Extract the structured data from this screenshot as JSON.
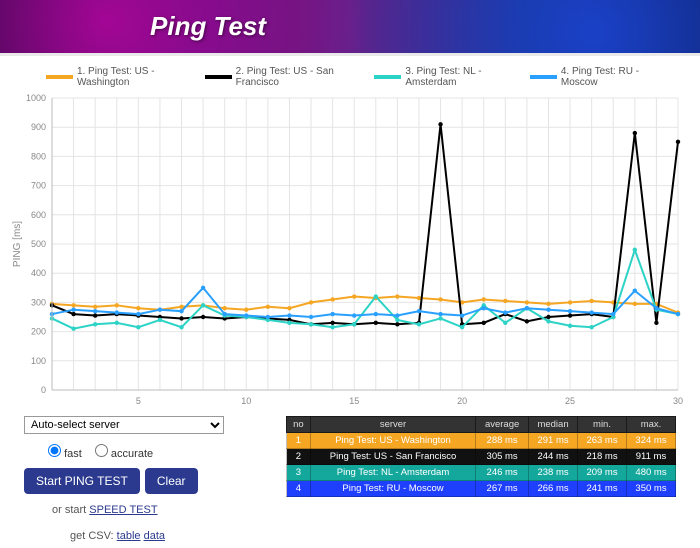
{
  "hero": {
    "title": "Ping Test"
  },
  "legend": [
    {
      "label": "1. Ping Test: US - Washington",
      "color": "#f5a623"
    },
    {
      "label": "2. Ping Test: US - San Francisco",
      "color": "#000000"
    },
    {
      "label": "3. Ping Test: NL - Amsterdam",
      "color": "#2dd3c6"
    },
    {
      "label": "4. Ping Test: RU - Moscow",
      "color": "#29a0ff"
    }
  ],
  "chart_data": {
    "type": "line",
    "title": "",
    "xlabel": "",
    "ylabel": "PING [ms]",
    "xlim": [
      1,
      30
    ],
    "ylim": [
      0,
      1000
    ],
    "xticks": [
      5,
      10,
      15,
      20,
      25,
      30
    ],
    "yticks": [
      0,
      100,
      200,
      300,
      400,
      500,
      600,
      700,
      800,
      900,
      1000
    ],
    "x": [
      1,
      2,
      3,
      4,
      5,
      6,
      7,
      8,
      9,
      10,
      11,
      12,
      13,
      14,
      15,
      16,
      17,
      18,
      19,
      20,
      21,
      22,
      23,
      24,
      25,
      26,
      27,
      28,
      29,
      30
    ],
    "series": [
      {
        "name": "1. Ping Test: US - Washington",
        "color": "#f5a623",
        "values": [
          295,
          290,
          285,
          290,
          280,
          275,
          285,
          290,
          280,
          275,
          285,
          280,
          300,
          310,
          320,
          315,
          320,
          315,
          310,
          300,
          310,
          305,
          300,
          295,
          300,
          305,
          300,
          295,
          295,
          265
        ]
      },
      {
        "name": "2. Ping Test: US - San Francisco",
        "color": "#000000",
        "values": [
          290,
          260,
          255,
          260,
          255,
          250,
          245,
          250,
          245,
          250,
          245,
          240,
          225,
          230,
          225,
          230,
          225,
          230,
          910,
          225,
          230,
          260,
          235,
          250,
          255,
          260,
          250,
          880,
          230,
          850
        ]
      },
      {
        "name": "3. Ping Test: NL - Amsterdam",
        "color": "#2dd3c6",
        "values": [
          245,
          210,
          225,
          230,
          215,
          240,
          215,
          290,
          255,
          250,
          240,
          230,
          225,
          215,
          225,
          320,
          240,
          225,
          245,
          215,
          290,
          230,
          280,
          235,
          220,
          215,
          250,
          480,
          275,
          260
        ]
      },
      {
        "name": "4. Ping Test: RU - Moscow",
        "color": "#29a0ff",
        "values": [
          260,
          275,
          270,
          265,
          260,
          275,
          270,
          350,
          260,
          255,
          250,
          255,
          250,
          260,
          255,
          260,
          255,
          270,
          260,
          255,
          280,
          265,
          280,
          275,
          270,
          265,
          260,
          340,
          280,
          260
        ]
      }
    ]
  },
  "controls": {
    "server_select": {
      "selected": "Auto-select server"
    },
    "mode": {
      "fast": "fast",
      "accurate": "accurate",
      "selected": "fast"
    },
    "start_btn": "Start PING TEST",
    "clear_btn": "Clear",
    "or_start_prefix": "or start ",
    "or_start_link": "SPEED TEST",
    "csv_prefix": "get CSV: ",
    "csv_table": "table",
    "csv_data": "data"
  },
  "results": {
    "headers": {
      "no": "no",
      "server": "server",
      "average": "average",
      "median": "median",
      "min": "min.",
      "max": "max."
    },
    "rows": [
      {
        "no": "1",
        "server": "Ping Test: US - Washington",
        "avg": "288 ms",
        "med": "291 ms",
        "min": "263 ms",
        "max": "324 ms",
        "bg": "#f5a623"
      },
      {
        "no": "2",
        "server": "Ping Test: US - San Francisco",
        "avg": "305 ms",
        "med": "244 ms",
        "min": "218 ms",
        "max": "911 ms",
        "bg": "#111111"
      },
      {
        "no": "3",
        "server": "Ping Test: NL - Amsterdam",
        "avg": "246 ms",
        "med": "238 ms",
        "min": "209 ms",
        "max": "480 ms",
        "bg": "#14a89d"
      },
      {
        "no": "4",
        "server": "Ping Test: RU - Moscow",
        "avg": "267 ms",
        "med": "266 ms",
        "min": "241 ms",
        "max": "350 ms",
        "bg": "#1f3fff"
      }
    ]
  }
}
